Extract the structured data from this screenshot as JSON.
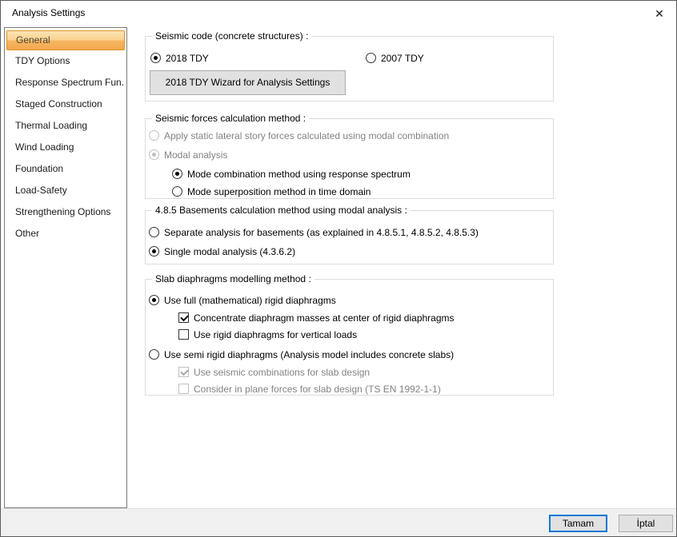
{
  "window": {
    "title": "Analysis Settings",
    "close_icon": "✕"
  },
  "sidebar": {
    "items": [
      "General",
      "TDY Options",
      "Response Spectrum Fun...",
      "Staged Construction",
      "Thermal Loading",
      "Wind Loading",
      "Foundation",
      "Load-Safety",
      "Strengthening Options",
      "Other"
    ],
    "selected": "General"
  },
  "groups": {
    "seismic_code": {
      "title": "Seismic code (concrete structures) :",
      "radio_2018": "2018 TDY",
      "radio_2007": "2007 TDY",
      "wizard_button": "2018 TDY Wizard for Analysis Settings"
    },
    "calc_method": {
      "title": "Seismic forces calculation method :",
      "apply_static": "Apply static lateral story forces calculated using modal combination",
      "modal_analysis": "Modal analysis",
      "mode_combination": "Mode combination method using response spectrum",
      "mode_superposition": "Mode superposition method in time domain"
    },
    "basements": {
      "title": "4.8.5 Basements calculation method using modal analysis :",
      "separate": "Separate analysis for basements (as explained in 4.8.5.1, 4.8.5.2, 4.8.5.3)",
      "single": "Single modal analysis (4.3.6.2)"
    },
    "slab": {
      "title": "Slab diaphragms modelling method :",
      "full_rigid": "Use full (mathematical) rigid diaphragms",
      "concentrate": "Concentrate diaphragm masses at center of rigid diaphragms",
      "vertical_loads": "Use rigid diaphragms for vertical loads",
      "semi_rigid": "Use semi rigid diaphragms (Analysis model includes concrete slabs)",
      "seismic_combinations": "Use seismic combinations for slab design",
      "in_plane": "Consider in plane forces for slab design (TS EN 1992-1-1)"
    }
  },
  "footer": {
    "ok_label": "Tamam",
    "cancel_label": "İptal"
  },
  "colors": {
    "default_button_border": "#0078d7",
    "selected_item_top": "#fde3b4",
    "selected_item_bottom": "#f3a74e",
    "selected_item_border": "#dd9425",
    "footer_bg": "#f0f0f0",
    "disabled_text": "#838383"
  }
}
